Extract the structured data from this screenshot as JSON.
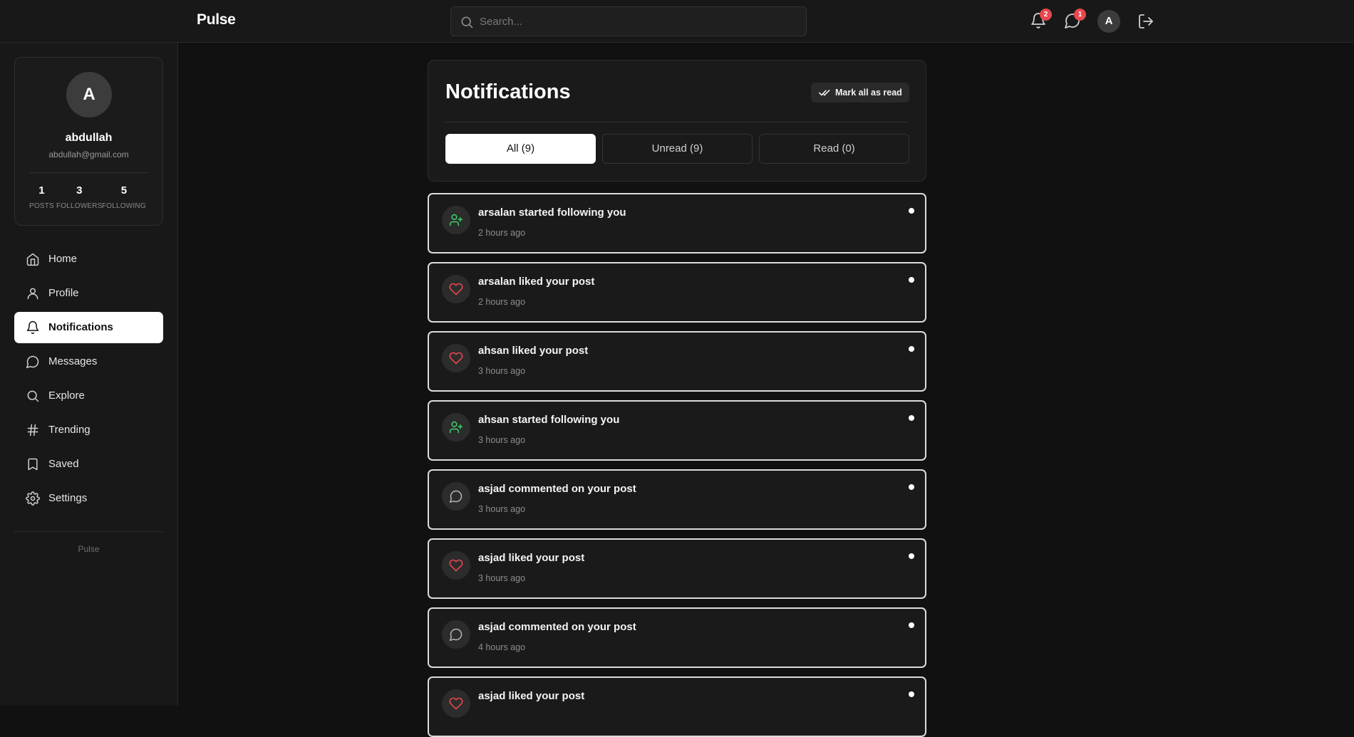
{
  "app": {
    "brand": "Pulse"
  },
  "search": {
    "placeholder": "Search..."
  },
  "topbar": {
    "notifications_badge": "2",
    "messages_badge": "1",
    "avatar_initial": "A"
  },
  "profile": {
    "initial": "A",
    "name": "abdullah",
    "email": "abdullah@gmail.com",
    "stats": [
      {
        "value": "1",
        "label": "POSTS"
      },
      {
        "value": "3",
        "label": "FOLLOWERS"
      },
      {
        "value": "5",
        "label": "FOLLOWING"
      }
    ]
  },
  "nav": {
    "items": [
      {
        "label": "Home",
        "icon": "home-icon"
      },
      {
        "label": "Profile",
        "icon": "user-icon"
      },
      {
        "label": "Notifications",
        "icon": "bell-icon",
        "active": true
      },
      {
        "label": "Messages",
        "icon": "message-circle-icon"
      },
      {
        "label": "Explore",
        "icon": "search-icon"
      },
      {
        "label": "Trending",
        "icon": "hash-icon"
      },
      {
        "label": "Saved",
        "icon": "bookmark-icon"
      },
      {
        "label": "Settings",
        "icon": "gear-icon"
      }
    ],
    "footer": "Pulse"
  },
  "notifications_page": {
    "title": "Notifications",
    "mark_all_label": "Mark all as read",
    "tabs": [
      {
        "label": "All (9)",
        "active": true
      },
      {
        "label": "Unread (9)"
      },
      {
        "label": "Read (0)"
      }
    ],
    "items": [
      {
        "text": "arsalan started following you",
        "time": "2 hours ago",
        "type": "follow"
      },
      {
        "text": "arsalan liked your post",
        "time": "2 hours ago",
        "type": "like"
      },
      {
        "text": "ahsan liked your post",
        "time": "3 hours ago",
        "type": "like"
      },
      {
        "text": "ahsan started following you",
        "time": "3 hours ago",
        "type": "follow"
      },
      {
        "text": "asjad commented on your post",
        "time": "3 hours ago",
        "type": "comment"
      },
      {
        "text": "asjad liked your post",
        "time": "3 hours ago",
        "type": "like"
      },
      {
        "text": "asjad commented on your post",
        "time": "4 hours ago",
        "type": "comment"
      },
      {
        "text": "asjad liked your post",
        "time": "",
        "type": "like"
      }
    ]
  },
  "colors": {
    "background": "#111111",
    "surface": "#1a1a1a",
    "badge": "#e5484d",
    "follow_icon": "#3ecf6e",
    "like_icon": "#e5484d",
    "comment_icon": "#b5b5b5"
  }
}
